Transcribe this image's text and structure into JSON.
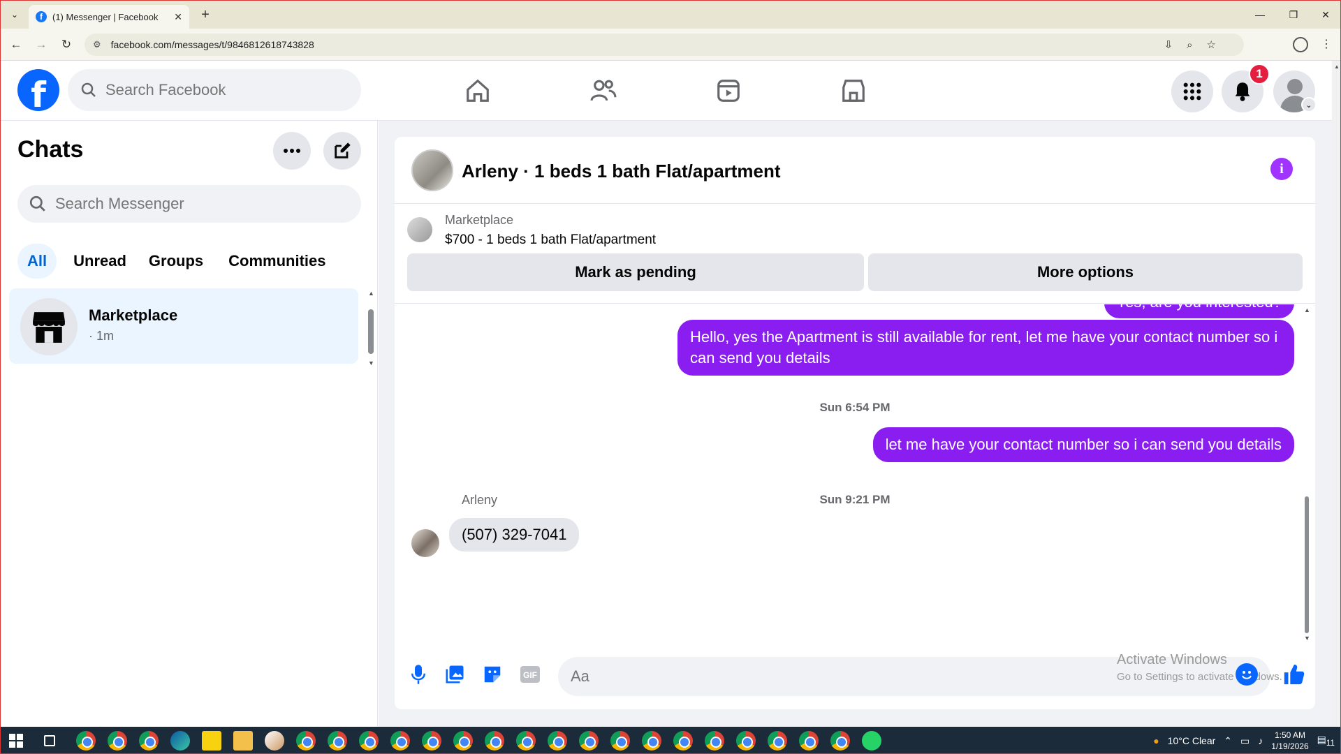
{
  "browser": {
    "tab_title": "(1) Messenger | Facebook",
    "url": "facebook.com/messages/t/9846812618743828"
  },
  "header": {
    "search_placeholder": "Search Facebook",
    "notification_count": "1"
  },
  "sidebar": {
    "title": "Chats",
    "search_placeholder": "Search Messenger",
    "filters": [
      "All",
      "Unread",
      "Groups",
      "Communities"
    ],
    "active_filter": "All",
    "chats": [
      {
        "name": "Marketplace",
        "time": "· 1m"
      }
    ]
  },
  "conversation": {
    "title": "Arleny · 1 beds 1 bath Flat/apartment",
    "marketplace": {
      "label": "Marketplace",
      "listing": "$700 - 1 beds 1 bath Flat/apartment",
      "pending_button": "Mark as pending",
      "more_button": "More options"
    },
    "messages": {
      "partial_out": "Yes, are you interested?",
      "out_1": "Hello, yes the Apartment is still available for rent, let me have your contact number so i can send you details",
      "timestamp_1": "Sun 6:54 PM",
      "out_2": "let me have your contact number so i can send you details",
      "timestamp_2": "Sun 9:21 PM",
      "sender": "Arleny",
      "in_1": "(507) 329-7041"
    },
    "composer_placeholder": "Aa",
    "watermark": {
      "line1": "Activate Windows",
      "line2": "Go to Settings to activate Windows."
    }
  },
  "taskbar": {
    "weather": "10°C  Clear",
    "time": "1:50 AM",
    "date": "1/19/2026",
    "notif_count": "11"
  },
  "colors": {
    "facebook_blue": "#0866ff",
    "message_purple": "#8a1df0",
    "active_filter_bg": "#ebf5ff"
  }
}
